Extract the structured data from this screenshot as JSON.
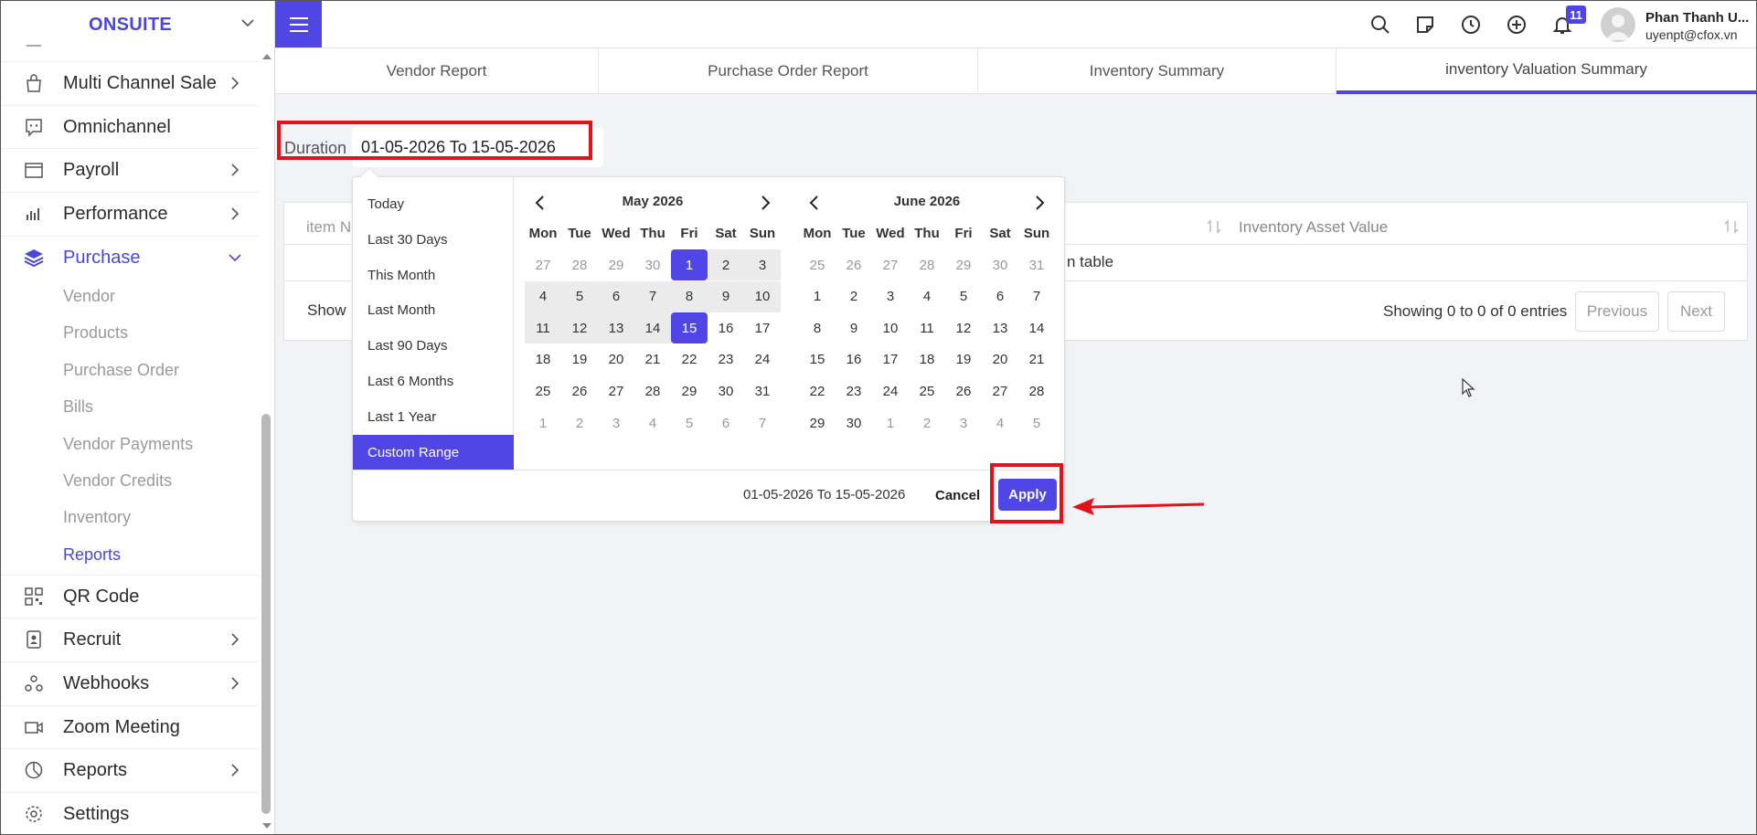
{
  "sidebar": {
    "brand": "ONSUITE",
    "items": [
      {
        "label": "Multi Channel Sale",
        "icon": "shopping-bag-icon",
        "has_arrow": true
      },
      {
        "label": "Omnichannel",
        "icon": "chat-icon",
        "has_arrow": false
      },
      {
        "label": "Payroll",
        "icon": "wallet-icon",
        "has_arrow": true
      },
      {
        "label": "Performance",
        "icon": "bar-chart-icon",
        "has_arrow": true
      },
      {
        "label": "Purchase",
        "icon": "layers-icon",
        "has_arrow": true,
        "expanded": true
      },
      {
        "label": "QR Code",
        "icon": "qr-code-icon",
        "has_arrow": false
      },
      {
        "label": "Recruit",
        "icon": "id-card-icon",
        "has_arrow": true
      },
      {
        "label": "Webhooks",
        "icon": "webhooks-icon",
        "has_arrow": true
      },
      {
        "label": "Zoom Meeting",
        "icon": "video-icon",
        "has_arrow": false
      },
      {
        "label": "Reports",
        "icon": "pie-chart-icon",
        "has_arrow": true
      },
      {
        "label": "Settings",
        "icon": "gear-icon",
        "has_arrow": false
      }
    ],
    "purchase_sub": [
      "Vendor",
      "Products",
      "Purchase Order",
      "Bills",
      "Vendor Payments",
      "Vendor Credits",
      "Inventory",
      "Reports"
    ],
    "active_sub": "Reports"
  },
  "topbar": {
    "notification_count": "11",
    "user_name": "Phan Thanh U...",
    "user_email": "uyenpt@cfox.vn",
    "icons": [
      "search-icon",
      "note-icon",
      "clock-icon",
      "plus-circle-icon",
      "bell-icon"
    ]
  },
  "tabs": [
    {
      "label": "Vendor Report",
      "active": false
    },
    {
      "label": "Purchase Order Report",
      "active": false
    },
    {
      "label": "Inventory Summary",
      "active": false
    },
    {
      "label": "inventory Valuation Summary",
      "active": true
    }
  ],
  "filter": {
    "duration_label": "Duration",
    "duration_value": "01-05-2026 To 15-05-2026"
  },
  "table": {
    "col_item": "item Na",
    "col_value": "Inventory Asset Value",
    "empty_text": "n table",
    "show_label": "Show",
    "entries_info": "Showing 0 to 0 of 0 entries",
    "prev_label": "Previous",
    "next_label": "Next"
  },
  "picker": {
    "ranges": [
      "Today",
      "Last 30 Days",
      "This Month",
      "Last Month",
      "Last 90 Days",
      "Last 6 Months",
      "Last 1 Year",
      "Custom Range"
    ],
    "active_range": "Custom Range",
    "weekdays": [
      "Mon",
      "Tue",
      "Wed",
      "Thu",
      "Fri",
      "Sat",
      "Sun"
    ],
    "left_title": "May 2026",
    "right_title": "June 2026",
    "left_days": [
      [
        "27",
        "28",
        "29",
        "30",
        "1",
        "2",
        "3"
      ],
      [
        "4",
        "5",
        "6",
        "7",
        "8",
        "9",
        "10"
      ],
      [
        "11",
        "12",
        "13",
        "14",
        "15",
        "16",
        "17"
      ],
      [
        "18",
        "19",
        "20",
        "21",
        "22",
        "23",
        "24"
      ],
      [
        "25",
        "26",
        "27",
        "28",
        "29",
        "30",
        "31"
      ],
      [
        "1",
        "2",
        "3",
        "4",
        "5",
        "6",
        "7"
      ]
    ],
    "right_days": [
      [
        "25",
        "26",
        "27",
        "28",
        "29",
        "30",
        "31"
      ],
      [
        "1",
        "2",
        "3",
        "4",
        "5",
        "6",
        "7"
      ],
      [
        "8",
        "9",
        "10",
        "11",
        "12",
        "13",
        "14"
      ],
      [
        "15",
        "16",
        "17",
        "18",
        "19",
        "20",
        "21"
      ],
      [
        "22",
        "23",
        "24",
        "25",
        "26",
        "27",
        "28"
      ],
      [
        "29",
        "30",
        "1",
        "2",
        "3",
        "4",
        "5"
      ]
    ],
    "selected_text": "01-05-2026 To 15-05-2026",
    "cancel_label": "Cancel",
    "apply_label": "Apply"
  },
  "colors": {
    "accent": "#4f46e5",
    "highlight": "#e3121a"
  }
}
